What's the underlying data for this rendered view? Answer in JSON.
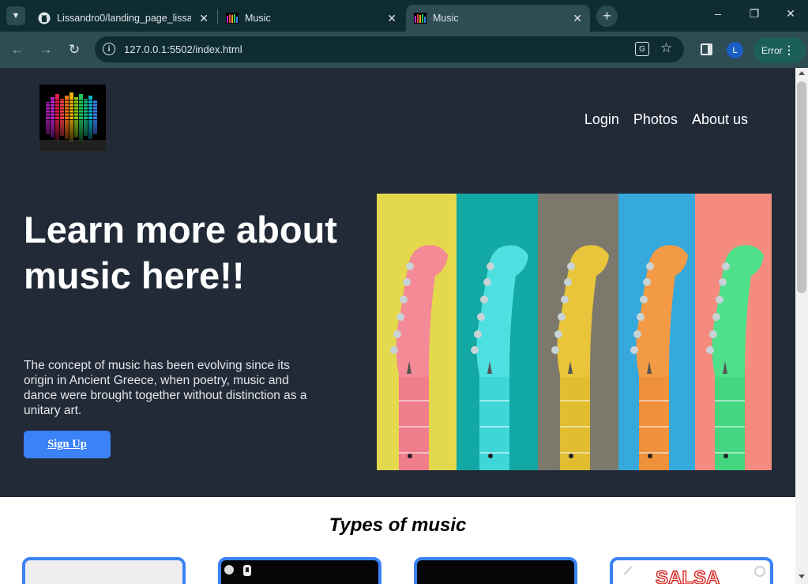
{
  "browser": {
    "tabs": [
      {
        "title": "Lissandro0/landing_page_lissan",
        "icon": "github-icon",
        "active": false
      },
      {
        "title": "Music",
        "icon": "equalizer-favicon",
        "active": false
      },
      {
        "title": "Music",
        "icon": "equalizer-favicon",
        "active": true
      }
    ],
    "url": "127.0.0.1:5502/index.html",
    "profile_initial": "L",
    "error_label": "Error",
    "colors": {
      "frame": "#0f2c33",
      "toolbar": "#2d4c54",
      "error_pill": "#1c5e5a"
    }
  },
  "page": {
    "nav": [
      "Login",
      "Photos",
      "About us"
    ],
    "hero": {
      "title": "Learn more about music here!!",
      "text": "The concept of music has been evolving since its origin in Ancient Greece, when poetry, music and dance were brought together without distinction as a unitary art.",
      "cta": "Sign Up",
      "image": "five-colored-guitar-headstocks"
    },
    "types_title": "Types of music",
    "cards": [
      {
        "image": "card-light-grey"
      },
      {
        "image": "card-dark-music"
      },
      {
        "image": "card-dark-green"
      },
      {
        "image": "card-salsa",
        "caption": "SALSA"
      }
    ],
    "colors": {
      "hero_bg": "#222a38",
      "accent": "#3b82f6"
    }
  }
}
